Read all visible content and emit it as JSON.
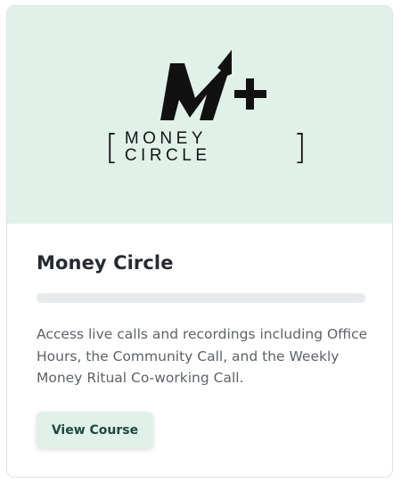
{
  "course": {
    "logo_text": "MONEY CIRCLE",
    "title": "Money Circle",
    "progress_percent": 0,
    "description": "Access live calls and recordings including Office Hours, the Community Call, and the Weekly Money Ritual Co-working Call.",
    "button_label": "View Course"
  },
  "colors": {
    "banner_bg": "#e0f1ea",
    "button_bg": "#e0f1ea",
    "button_text": "#1e4a3d",
    "title_text": "#262b32",
    "body_text": "#5d626b",
    "progress_track": "#e7e9ec"
  },
  "icons": {
    "logo": "m-plus-arrow-logo"
  }
}
